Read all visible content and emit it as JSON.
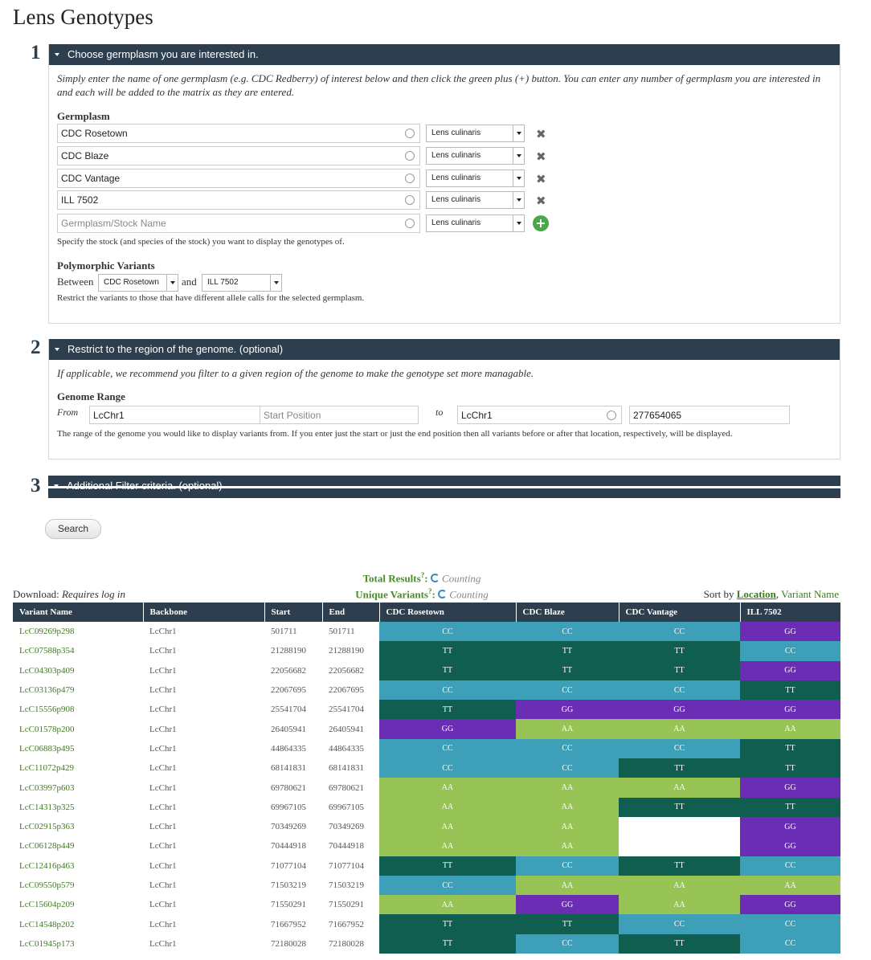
{
  "page_title": "Lens Genotypes",
  "steps": [
    {
      "number": "1",
      "title": "Choose germplasm you are interested in."
    },
    {
      "number": "2",
      "title": "Restrict to the region of the genome. (optional)"
    },
    {
      "number": "3",
      "title": "Additional Filter criteria. (optional)"
    }
  ],
  "section1": {
    "help": "Simply enter the name of one germplasm (e.g. CDC Redberry) of interest below and then click the green plus (+) button. You can enter any number of germplasm you are interested in and each will be added to the matrix as they are entered.",
    "germplasm_label": "Germplasm",
    "rows": [
      {
        "name": "CDC Rosetown",
        "species": "Lens culinaris"
      },
      {
        "name": "CDC Blaze",
        "species": "Lens culinaris"
      },
      {
        "name": "CDC Vantage",
        "species": "Lens culinaris"
      },
      {
        "name": "ILL 7502",
        "species": "Lens culinaris"
      }
    ],
    "new_row": {
      "placeholder": "Germplasm/Stock Name",
      "species": "Lens culinaris"
    },
    "stock_desc": "Specify the stock (and species of the stock) you want to display the genotypes of.",
    "poly_label": "Polymorphic Variants",
    "between_label": "Between",
    "between_value": "CDC Rosetown",
    "and_label": "and",
    "and_value": "ILL 7502",
    "poly_desc": "Restrict the variants to those that have different allele calls for the selected germplasm."
  },
  "section2": {
    "help": "If applicable, we recommend you filter to a given region of the genome to make the genotype set more managable.",
    "range_label": "Genome Range",
    "from_label": "From",
    "from_backbone": "LcChr1",
    "start_placeholder": "Start Position",
    "to_label": "to",
    "to_backbone": "LcChr1",
    "end_value": "277654065",
    "range_desc": "The range of the genome you would like to display variants from. If you enter just the start or just the end position then all variants before or after that location, respectively, will be displayed."
  },
  "search_button": "Search",
  "summary": {
    "total_label": "Total Results",
    "unique_label": "Unique Variants",
    "help_mark": "?",
    "colon": ":",
    "total_value": "Counting",
    "unique_value": "Counting"
  },
  "download": {
    "label": "Download:",
    "value": "Requires log in"
  },
  "sort": {
    "label": "Sort by",
    "option1": "Location",
    "separator": ",",
    "option2": "Variant Name"
  },
  "table": {
    "headers": [
      "Variant Name",
      "Backbone",
      "Start",
      "End",
      "CDC Rosetown",
      "CDC Blaze",
      "CDC Vantage",
      "ILL 7502"
    ],
    "rows": [
      [
        "LcC09269p298",
        "LcChr1",
        "501711",
        "501711",
        "CC",
        "CC",
        "CC",
        "GG"
      ],
      [
        "LcC07588p354",
        "LcChr1",
        "21288190",
        "21288190",
        "TT",
        "TT",
        "TT",
        "CC"
      ],
      [
        "LcC04303p409",
        "LcChr1",
        "22056682",
        "22056682",
        "TT",
        "TT",
        "TT",
        "GG"
      ],
      [
        "LcC03136p479",
        "LcChr1",
        "22067695",
        "22067695",
        "CC",
        "CC",
        "CC",
        "TT"
      ],
      [
        "LcC15556p908",
        "LcChr1",
        "25541704",
        "25541704",
        "TT",
        "GG",
        "GG",
        "GG"
      ],
      [
        "LcC01578p200",
        "LcChr1",
        "26405941",
        "26405941",
        "GG",
        "AA",
        "AA",
        "AA"
      ],
      [
        "LcC06883p495",
        "LcChr1",
        "44864335",
        "44864335",
        "CC",
        "CC",
        "CC",
        "TT"
      ],
      [
        "LcC11072p429",
        "LcChr1",
        "68141831",
        "68141831",
        "CC",
        "CC",
        "TT",
        "TT"
      ],
      [
        "LcC03997p603",
        "LcChr1",
        "69780621",
        "69780621",
        "AA",
        "AA",
        "AA",
        "GG"
      ],
      [
        "LcC14313p325",
        "LcChr1",
        "69967105",
        "69967105",
        "AA",
        "AA",
        "TT",
        "TT"
      ],
      [
        "LcC02915p363",
        "LcChr1",
        "70349269",
        "70349269",
        "AA",
        "AA",
        "",
        "GG"
      ],
      [
        "LcC06128p449",
        "LcChr1",
        "70444918",
        "70444918",
        "AA",
        "AA",
        "",
        "GG"
      ],
      [
        "LcC12416p463",
        "LcChr1",
        "71077104",
        "71077104",
        "TT",
        "CC",
        "TT",
        "CC"
      ],
      [
        "LcC09550p579",
        "LcChr1",
        "71503219",
        "71503219",
        "CC",
        "AA",
        "AA",
        "AA"
      ],
      [
        "LcC15604p209",
        "LcChr1",
        "71550291",
        "71550291",
        "AA",
        "GG",
        "AA",
        "GG"
      ],
      [
        "LcC14548p202",
        "LcChr1",
        "71667952",
        "71667952",
        "TT",
        "TT",
        "CC",
        "CC"
      ],
      [
        "LcC01945p173",
        "LcChr1",
        "72180028",
        "72180028",
        "TT",
        "CC",
        "TT",
        "CC"
      ]
    ]
  },
  "colors": {
    "CC": "#3e9fb8",
    "TT": "#0f5e50",
    "GG": "#6a2db3",
    "AA": "#97c454",
    "header": "#2d3e4e",
    "link": "#3f7a1e"
  }
}
